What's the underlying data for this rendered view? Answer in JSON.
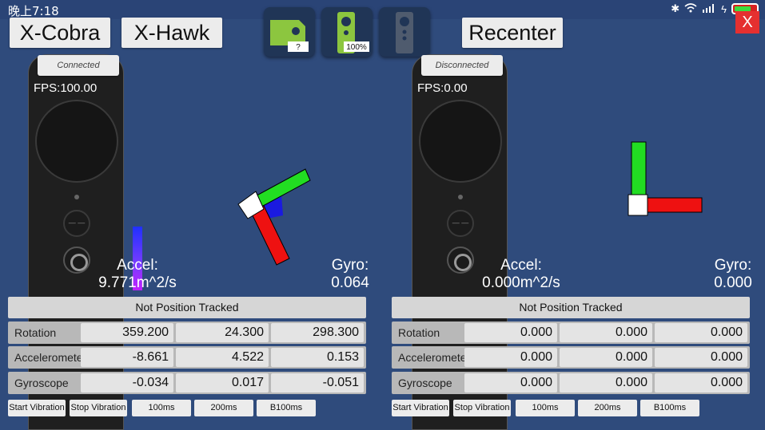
{
  "status": {
    "time": "晚上7:18",
    "icons": [
      "bluetooth-icon",
      "wifi-icon",
      "signal-icon",
      "charging-icon",
      "battery-icon"
    ]
  },
  "top": {
    "cobra_label": "X-Cobra",
    "hawk_label": "X-Hawk",
    "recenter_label": "Recenter",
    "close_label": "X",
    "tiles": [
      {
        "badge": "?"
      },
      {
        "badge": "100%"
      },
      {
        "badge": ""
      }
    ]
  },
  "left": {
    "conn": "Connected",
    "fps": "FPS:100.00",
    "accel_label": "Accel:",
    "accel_value": "9.771m^2/s",
    "gyro_label": "Gyro:",
    "gyro_value": "0.064",
    "tracking": "Not Position Tracked",
    "rotation": {
      "label": "Rotation",
      "values": [
        "359.200",
        "24.300",
        "298.300"
      ]
    },
    "accelerometer": {
      "label": "Accelerometer",
      "values": [
        "-8.661",
        "4.522",
        "0.153"
      ]
    },
    "gyroscope": {
      "label": "Gyroscope",
      "values": [
        "-0.034",
        "0.017",
        "-0.051"
      ]
    },
    "buttons": [
      "Start Vibration",
      "Stop Vibration",
      "100ms",
      "200ms",
      "B100ms"
    ]
  },
  "right": {
    "conn": "Disconnected",
    "fps": "FPS:0.00",
    "accel_label": "Accel:",
    "accel_value": "0.000m^2/s",
    "gyro_label": "Gyro:",
    "gyro_value": "0.000",
    "tracking": "Not Position Tracked",
    "rotation": {
      "label": "Rotation",
      "values": [
        "0.000",
        "0.000",
        "0.000"
      ]
    },
    "accelerometer": {
      "label": "Accelerometer",
      "values": [
        "0.000",
        "0.000",
        "0.000"
      ]
    },
    "gyroscope": {
      "label": "Gyroscope",
      "values": [
        "0.000",
        "0.000",
        "0.000"
      ]
    },
    "buttons": [
      "Start Vibration",
      "Stop Vibration",
      "100ms",
      "200ms",
      "B100ms"
    ]
  }
}
